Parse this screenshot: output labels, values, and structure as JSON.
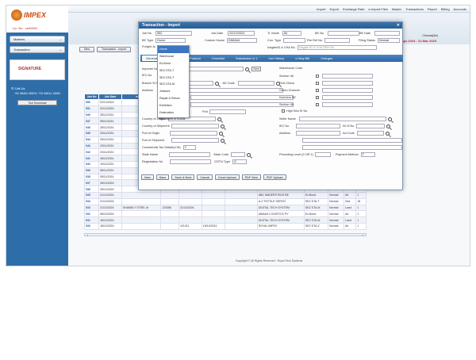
{
  "topmenu": [
    "Import",
    "Export",
    "Exchange Rate",
    "e-Import Files",
    "Master",
    "Transactions",
    "Report",
    "Billing",
    "Accounts"
  ],
  "sidebar": {
    "brand": "IMPEX",
    "license": "Lic. No : ce00001",
    "items": [
      "Masters",
      "Transaction"
    ],
    "signature": "SIGNATURE",
    "call_label": "Call Us",
    "phones": "+91 98402 45678 / +91 90814 13080",
    "tool_download": "Tool Download"
  },
  "header": {
    "city": "Chennai(Air)",
    "period": "1-Apr-2024 - 31-Mar-2025"
  },
  "bg_toolbar": [
    "New",
    "Transaction - Import"
  ],
  "bg_columns": [
    "Job No",
    "Job Date",
    "Importer",
    "IGM Date",
    "BE No",
    "BE Date",
    "Consignee Name",
    "BE Type",
    "Scheme",
    "Mode",
    "Pkgs",
    "Cont"
  ],
  "bg_rows": [
    [
      "550",
      "02/12/2024",
      "",
      "",
      "",
      "",
      "",
      "",
      "",
      "",
      "",
      ""
    ],
    [
      "551",
      "02/12/2024",
      "",
      "",
      "",
      "",
      "",
      "",
      "",
      "",
      "",
      ""
    ],
    [
      "549",
      "28/11/2024",
      "",
      "",
      "",
      "",
      "",
      "",
      "",
      "",
      "",
      ""
    ],
    [
      "547",
      "08/11/2024",
      "",
      "",
      "",
      "",
      "",
      "",
      "",
      "",
      "",
      ""
    ],
    [
      "546",
      "28/11/2024",
      "",
      "",
      "",
      "",
      "",
      "",
      "",
      "",
      "",
      ""
    ],
    [
      "545",
      "25/11/2024",
      "",
      "",
      "",
      "",
      "",
      "",
      "",
      "",
      "",
      ""
    ],
    [
      "544",
      "25/11/2024",
      "",
      "",
      "",
      "",
      "",
      "",
      "",
      "",
      "",
      ""
    ],
    [
      "543",
      "23/11/2024",
      "",
      "",
      "",
      "",
      "",
      "",
      "",
      "",
      "",
      ""
    ],
    [
      "542",
      "23/11/2024",
      "",
      "",
      "",
      "",
      "",
      "",
      "",
      "",
      "",
      ""
    ],
    [
      "541",
      "18/11/2024",
      "",
      "",
      "",
      "",
      "",
      "",
      "",
      "",
      "",
      ""
    ],
    [
      "540",
      "15/11/2024",
      "",
      "",
      "",
      "",
      "",
      "",
      "",
      "",
      "",
      ""
    ],
    [
      "539",
      "08/11/2024",
      "",
      "",
      "",
      "",
      "",
      "",
      "",
      "",
      "",
      ""
    ],
    [
      "538",
      "05/11/2024",
      "",
      "",
      "",
      "",
      "",
      "",
      "",
      "",
      "",
      ""
    ],
    [
      "537",
      "28/10/2024",
      "",
      "",
      "",
      "",
      "",
      "",
      "",
      "",
      "",
      ""
    ],
    [
      "536",
      "28/10/2024",
      "",
      "",
      "",
      "",
      "",
      "",
      "",
      "",
      "",
      ""
    ],
    [
      "535",
      "21/10/2024",
      "",
      "",
      "",
      "",
      "",
      "ABC MADERS RICE BE",
      "Ex-Bond",
      "Normal",
      "Air",
      "1"
    ],
    [
      "534",
      "21/10/2024",
      "",
      "",
      "",
      "",
      "",
      "A-Z TEXTILE SERVIC",
      "SEZ DTA-T",
      "Normal",
      "Sea",
      "18"
    ],
    [
      "533",
      "21/10/2024",
      "SHAMELY STEEL M",
      "123456",
      "21/10/2024",
      "",
      "",
      "DIGITAL TECH SYSTEM",
      "SEZ DTA-M",
      "Normal",
      "Land",
      "1"
    ],
    [
      "532",
      "08/10/2024",
      "",
      "",
      "",
      "",
      "",
      "AWAAS LOGISTICS PV",
      "Ex-Bond",
      "Normal",
      "Air",
      "1"
    ],
    [
      "531",
      "18/10/2024",
      "",
      "",
      "",
      "",
      "",
      "DIGITAL TECH SYSTEM",
      "SEZ DTA-M",
      "Normal",
      "Land",
      "1"
    ],
    [
      "530",
      "18/10/2024",
      "",
      "",
      "121211",
      "18/10/2024",
      "",
      "ROYAL IMPEX",
      "SEZ DTA-Z",
      "Normal",
      "Air",
      "1"
    ]
  ],
  "copyright": "Copyright © All Rights Reserved : Royal Tech Systems",
  "modal": {
    "title": "Transaction - Import",
    "job_no_label": "Job No",
    "job_no": "552",
    "job_date_label": "Job Date",
    "job_date": "02/12/2024",
    "tr_mode_label": "Tr. Mode",
    "tr_mode": "Air",
    "be_no_label": "BE No",
    "be_date_label": "BE Date",
    "be_type_label": "BE Type",
    "be_type": "Home",
    "custom_house_label": "Custom House",
    "custom_house": "INMAA4",
    "con_type_label": "Con. Type",
    "file_ref_label": "File Ref No",
    "filing_status_label": "Filing Status",
    "filing_status": "Normal",
    "freight_label": "Freight Js",
    "icegate_label": "IcegateID & CHA No",
    "icegate_placeholder": "Icegate ID & CHA PAN No",
    "tabs": [
      "General",
      "Invoice",
      "Product",
      "Checklist",
      "Submission # 1",
      "Job History",
      "e-Way Bill",
      "Charges"
    ],
    "importer_label": "Importer Name",
    "new_label": "New",
    "iec_label": "IEC No",
    "branch_label": "Branch Sl No",
    "ad_code_label": "AD Code",
    "address_label": "Address",
    "port_label": "Port",
    "country_origin_label": "Country of Origin",
    "country_shipment_label": "Country of Shipment",
    "port_origin_label": "Port of Origin",
    "port_shipment_label": "Port of Shipment",
    "commercial_tax_label": "Commercial Tax Details(Y/N)",
    "commercial_tax": "Y",
    "state_name_label": "State Name",
    "state_code_label": "State Code",
    "registration_label": "Registration No",
    "gstin_type_label": "GSTN Type",
    "gstin_type": "G",
    "warehouse_label": "Warehouse Code",
    "section46_label": "Section 46",
    "first_check_label": "First Check",
    "green_channel_label": "Green Channel",
    "kachcha_label": "Kachcha BE",
    "section48_label": "Section 48",
    "high_sea_label": "High Sea Sr No",
    "seller_label": "Seller Name",
    "seller_iec_label": "IEC No",
    "br_sl_label": "Br Sl No",
    "seller_address_label": "Address",
    "seller_ad_label": "Ad Code",
    "preceding_label": "Preceding Level (0 OR 1)",
    "payment_label": "Payment Method",
    "payment": "T",
    "buttons": [
      "New",
      "Save",
      "Save & Next",
      "Cancel",
      "Excel Upload",
      "PDF New",
      "PDF Upload"
    ],
    "be_type_options": [
      "Home",
      "Warehouse",
      "Ex-Bond",
      "SEZ DTA-T",
      "SEZ DTA-T",
      "SEZ DTA-M",
      "Jobwork",
      "Repair & Return",
      "Exhibition",
      "Destruction",
      "Movement of Goods"
    ],
    "be_type_selected_index": 0
  }
}
